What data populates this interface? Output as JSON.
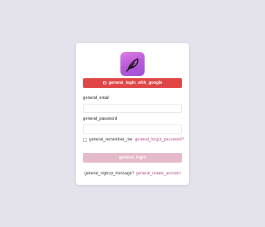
{
  "colors": {
    "background": "#e4e3ec",
    "google_button": "#e04545",
    "login_button": "#e4b9c9",
    "link": "#b04a87",
    "logo_gradient": [
      "#e07fe6",
      "#9d4fd6"
    ]
  },
  "logo": {
    "icon": "feather-icon"
  },
  "google_login": {
    "icon": "google-g-icon",
    "icon_glyph": "G",
    "label": "general_login_with_google"
  },
  "form": {
    "email_label": "general_email",
    "email_value": "",
    "email_placeholder": "",
    "password_label": "general_password",
    "password_value": "",
    "password_placeholder": "",
    "remember_me_label": "general_remember_me",
    "remember_me_checked": false,
    "forgot_password_link": "general_forgot_password?"
  },
  "login_button": {
    "label": "general_login"
  },
  "signup": {
    "message": "general_signup_message?",
    "create_account_link": "general_create_account"
  }
}
